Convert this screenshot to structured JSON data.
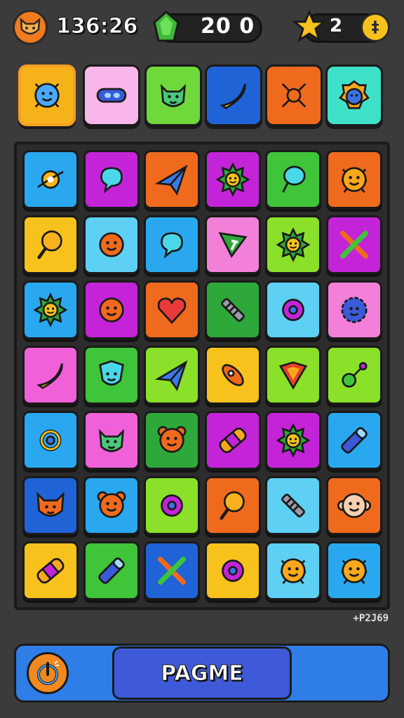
{
  "hud": {
    "timer": "136:26",
    "gems": "20 0",
    "coins": "2",
    "coin_symbol": "‡"
  },
  "queue": [
    {
      "color": "#f6b21a",
      "icon": "robot-face-icon",
      "selected": true
    },
    {
      "color": "#f9b6e8",
      "icon": "pill-capsule-icon",
      "selected": false
    },
    {
      "color": "#6fd83b",
      "icon": "cat-face-icon",
      "selected": false
    },
    {
      "color": "#1f63d6",
      "icon": "banana-icon",
      "selected": false
    },
    {
      "color": "#f06a1e",
      "icon": "crossed-tools-icon",
      "selected": false
    },
    {
      "color": "#3fe0c8",
      "icon": "lion-face-icon",
      "selected": false
    }
  ],
  "board": [
    [
      {
        "color": "#29a8f0",
        "icon": "planet-icon"
      },
      {
        "color": "#c424d8",
        "icon": "speech-bubble-icon"
      },
      {
        "color": "#f06a1e",
        "icon": "paper-plane-icon"
      },
      {
        "color": "#c424d8",
        "icon": "sun-face-icon"
      },
      {
        "color": "#3fc43a",
        "icon": "balloon-icon"
      },
      {
        "color": "#f06a1e",
        "icon": "bug-icon"
      }
    ],
    [
      {
        "color": "#f8c21d",
        "icon": "lollipop-icon"
      },
      {
        "color": "#5ed0f4",
        "icon": "smiley-face-icon"
      },
      {
        "color": "#29a8f0",
        "icon": "speech-bubble-icon"
      },
      {
        "color": "#f280d8",
        "icon": "flag-icon"
      },
      {
        "color": "#8be02a",
        "icon": "sun-face-icon"
      },
      {
        "color": "#c424d8",
        "icon": "crossed-swords-icon"
      }
    ],
    [
      {
        "color": "#29a8f0",
        "icon": "sun-face-icon"
      },
      {
        "color": "#c424d8",
        "icon": "smiley-face-icon"
      },
      {
        "color": "#f06a1e",
        "icon": "heart-icon"
      },
      {
        "color": "#2ea83a",
        "icon": "screw-icon"
      },
      {
        "color": "#5ed0f4",
        "icon": "donut-icon"
      },
      {
        "color": "#f280d8",
        "icon": "gear-face-icon"
      }
    ],
    [
      {
        "color": "#f060d8",
        "icon": "banana-icon"
      },
      {
        "color": "#3fc43a",
        "icon": "shield-face-icon"
      },
      {
        "color": "#8be02a",
        "icon": "paper-plane-icon"
      },
      {
        "color": "#f8c21d",
        "icon": "rocket-icon"
      },
      {
        "color": "#8be02a",
        "icon": "shield-icon"
      },
      {
        "color": "#8be02a",
        "icon": "key-icon"
      }
    ],
    [
      {
        "color": "#29a8f0",
        "icon": "recycle-icon"
      },
      {
        "color": "#f060d8",
        "icon": "cat-face-icon"
      },
      {
        "color": "#2ea83a",
        "icon": "bear-face-icon"
      },
      {
        "color": "#c424d8",
        "icon": "bandage-icon"
      },
      {
        "color": "#c424d8",
        "icon": "sun-face-icon"
      },
      {
        "color": "#29a8f0",
        "icon": "pencil-icon"
      }
    ],
    [
      {
        "color": "#1f63d6",
        "icon": "fox-face-icon"
      },
      {
        "color": "#29a8f0",
        "icon": "bear-face-icon"
      },
      {
        "color": "#8be02a",
        "icon": "donut-icon"
      },
      {
        "color": "#f06a1e",
        "icon": "lollipop-icon"
      },
      {
        "color": "#5ed0f4",
        "icon": "screw-icon"
      },
      {
        "color": "#f06a1e",
        "icon": "monkey-face-icon"
      }
    ],
    [
      {
        "color": "#f8c21d",
        "icon": "bandage-icon"
      },
      {
        "color": "#3fc43a",
        "icon": "pencil-icon"
      },
      {
        "color": "#1f63d6",
        "icon": "crossed-swords-icon"
      },
      {
        "color": "#f8c21d",
        "icon": "donut-icon"
      },
      {
        "color": "#5ed0f4",
        "icon": "bug-icon"
      },
      {
        "color": "#29a8f0",
        "icon": "bug-icon"
      }
    ]
  ],
  "footer": {
    "version": "+P2J69",
    "main_button": "PAGME"
  }
}
